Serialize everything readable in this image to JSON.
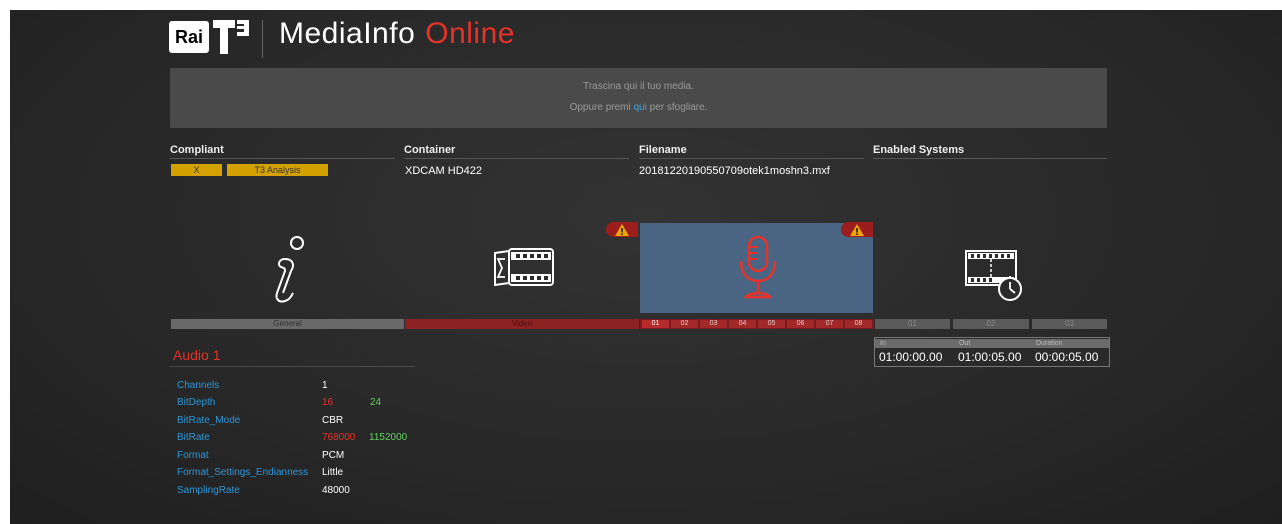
{
  "header": {
    "logo_rai": "Rai",
    "title_main": "MediaInfo",
    "title_accent": "Online"
  },
  "dropzone": {
    "line1": "Trascina qui il tuo media.",
    "line2_prefix": "Oppure premi",
    "line2_link": "qui",
    "line2_suffix": "per sfogliare."
  },
  "summary": {
    "compliant_label": "Compliant",
    "container_label": "Container",
    "filename_label": "Filename",
    "enabled_label": "Enabled Systems",
    "compliant_mark": "X",
    "analysis_button": "T3 Analysis",
    "container_value": "XDCAM HD422",
    "filename_value": "20181220190550709otek1moshn3.mxf"
  },
  "tabs": {
    "general": "General",
    "video": "Video",
    "audio_tracks": [
      "01",
      "02",
      "03",
      "04",
      "05",
      "06",
      "07",
      "08"
    ],
    "text_tracks": [
      "01",
      "02",
      "03"
    ]
  },
  "timecode": {
    "in_label": "In",
    "out_label": "Out",
    "duration_label": "Duration",
    "in_value": "01:00:00.00",
    "out_value": "01:00:05.00",
    "duration_value": "00:00:05.00"
  },
  "audio_section": {
    "title": "Audio 1",
    "props": [
      {
        "key": "Channels",
        "value": "1"
      },
      {
        "key": "BitDepth",
        "value": "16",
        "expected": "24"
      },
      {
        "key": "BitRate_Mode",
        "value": "CBR"
      },
      {
        "key": "BitRate",
        "value": "768000",
        "expected": "1152000"
      },
      {
        "key": "Format",
        "value": "PCM"
      },
      {
        "key": "Format_Settings_Endianness",
        "value": "Little"
      },
      {
        "key": "SamplingRate",
        "value": "48000"
      }
    ]
  },
  "icons": {
    "general": "info-icon",
    "video": "film-sum-icon",
    "audio": "microphone-icon",
    "timecode": "film-stopwatch-icon",
    "warning": "warning-icon"
  },
  "colors": {
    "accent_red": "#e5332a",
    "link_blue": "#2e96d6",
    "ok_green": "#5fd35f",
    "pill_yellow": "#d4a200",
    "audio_panel": "#4a6483"
  }
}
